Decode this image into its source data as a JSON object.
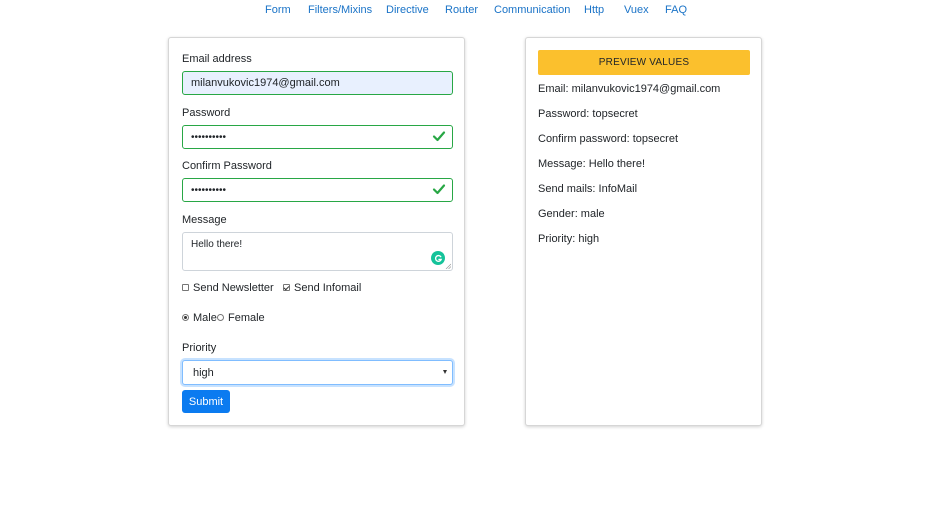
{
  "nav": {
    "items": [
      "Form",
      "Filters/Mixins",
      "Directive",
      "Router",
      "Communication",
      "Http",
      "Vuex",
      "FAQ"
    ]
  },
  "form": {
    "email_label": "Email address",
    "email_value": "milanvukovic1974@gmail.com",
    "password_label": "Password",
    "password_mask": "••••••••••",
    "confirm_label": "Confirm Password",
    "confirm_mask": "••••••••••",
    "message_label": "Message",
    "message_value": "Hello there!",
    "checkbox_newsletter": "Send Newsletter",
    "checkbox_infomail": "Send Infomail",
    "radio_male": "Male",
    "radio_female": "Female",
    "priority_label": "Priority",
    "priority_value": "high",
    "submit_label": "Submit"
  },
  "preview": {
    "button_label": "PREVIEW VALUES",
    "email": "Email: milanvukovic1974@gmail.com",
    "password": "Password: topsecret",
    "confirm": "Confirm password: topsecret",
    "message": "Message: Hello there!",
    "send_mails": "Send mails: InfoMail",
    "gender": "Gender: male",
    "priority": "Priority: high"
  },
  "colors": {
    "link": "#1a73c7",
    "valid": "#28a745",
    "primary": "#0b7bf0",
    "preview_button": "#fbc02d",
    "grammarly": "#15c39a"
  }
}
